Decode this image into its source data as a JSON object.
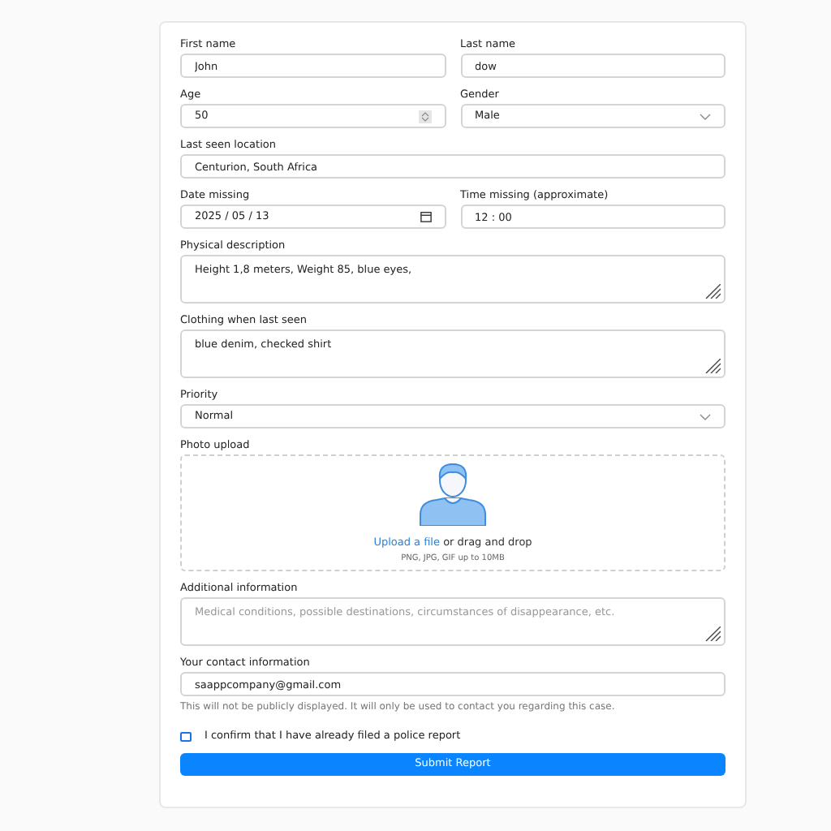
{
  "rows": [
    {
      "fields": [
        {
          "kind": "text",
          "label": "First name",
          "value": "John"
        },
        {
          "kind": "text",
          "label": "Last name",
          "value": "dow"
        }
      ]
    },
    {
      "fields": [
        {
          "kind": "number",
          "label": "Age",
          "value": "50"
        },
        {
          "kind": "select",
          "label": "Gender",
          "value": "Male"
        }
      ]
    },
    {
      "fields": [
        {
          "kind": "text",
          "label": "Last seen location",
          "value": "Centurion, South Africa"
        }
      ]
    },
    {
      "fields": [
        {
          "kind": "date",
          "label": "Date missing",
          "value": "2025 / 05 / 13"
        },
        {
          "kind": "text",
          "label": "Time missing (approximate)",
          "value": "12 : 00"
        }
      ]
    },
    {
      "fields": [
        {
          "kind": "textarea",
          "label": "Physical description",
          "value": "Height 1,8 meters, Weight 85, blue eyes,"
        }
      ]
    },
    {
      "fields": [
        {
          "kind": "textarea",
          "label": "Clothing when last seen",
          "value": "blue denim, checked shirt"
        }
      ]
    },
    {
      "fields": [
        {
          "kind": "select",
          "label": "Priority",
          "value": "Normal"
        }
      ]
    },
    {
      "fields": [
        {
          "kind": "upload",
          "label": "Photo upload",
          "link": "Upload a file",
          "text": "or drag and drop",
          "hint": "PNG, JPG, GIF up to 10MB"
        }
      ]
    },
    {
      "fields": [
        {
          "kind": "textarea",
          "label": "Additional information",
          "placeholder": "Medical conditions, possible destinations, circumstances of disappearance, etc."
        }
      ]
    },
    {
      "fields": [
        {
          "kind": "text",
          "label": "Your contact information",
          "value": "saappcompany@gmail.com",
          "help": "This will not be publicly displayed. It will only be used to contact you regarding this case."
        }
      ]
    }
  ],
  "confirm": {
    "label": "I confirm that I have already filed a police report",
    "checked": false
  },
  "submit": "Submit Report"
}
